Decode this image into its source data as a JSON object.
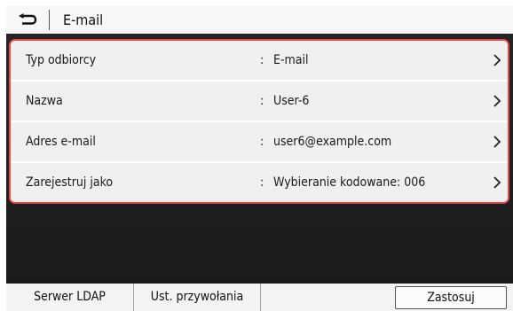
{
  "header": {
    "title": "E-mail",
    "back_icon": "back-arrow-icon"
  },
  "rows": [
    {
      "label": "Typ odbiorcy",
      "value": "E-mail"
    },
    {
      "label": "Nazwa",
      "value": "User-6"
    },
    {
      "label": "Adres e-mail",
      "value": "user6@example.com"
    },
    {
      "label": "Zarejestruj jako",
      "value": "Wybieranie kodowane: 006"
    }
  ],
  "separator": ":",
  "toolbar": {
    "ldap_label": "Serwer LDAP",
    "call_settings_label": "Ust. przywołania",
    "apply_label": "Zastosuj"
  },
  "colors": {
    "highlight_border": "#e64a4a",
    "screen_bg": "#222222"
  }
}
